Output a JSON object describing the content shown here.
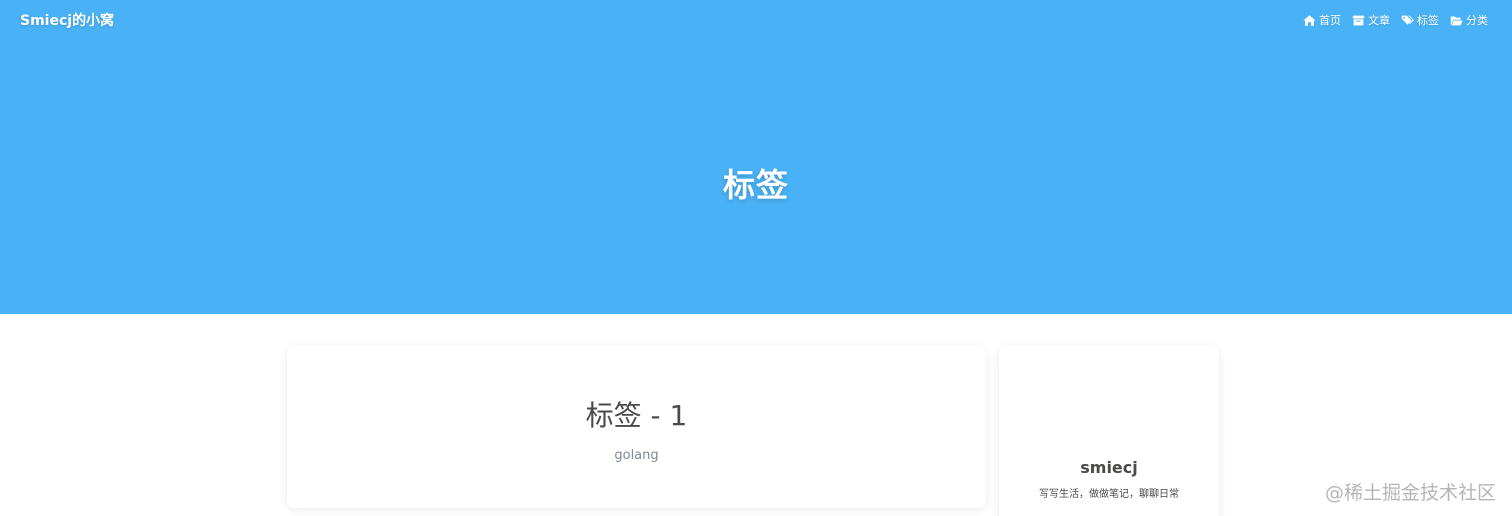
{
  "navbar": {
    "brand": "Smiecj的小窝",
    "menu": [
      {
        "label": "首页",
        "icon": "home-icon"
      },
      {
        "label": "文章",
        "icon": "archive-icon"
      },
      {
        "label": "标签",
        "icon": "tags-icon"
      },
      {
        "label": "分类",
        "icon": "folder-open-icon"
      }
    ]
  },
  "hero": {
    "title": "标签"
  },
  "main": {
    "heading": "标签 - 1",
    "tags": [
      "golang"
    ]
  },
  "sidebar": {
    "author_name": "smiecj",
    "author_desc": "写写生活，做做笔记，聊聊日常"
  },
  "watermark": "@稀土掘金技术社区",
  "colors": {
    "hero_background": "#49b1f5",
    "text_primary": "#4c4948",
    "tag_link": "#7f8a96"
  }
}
